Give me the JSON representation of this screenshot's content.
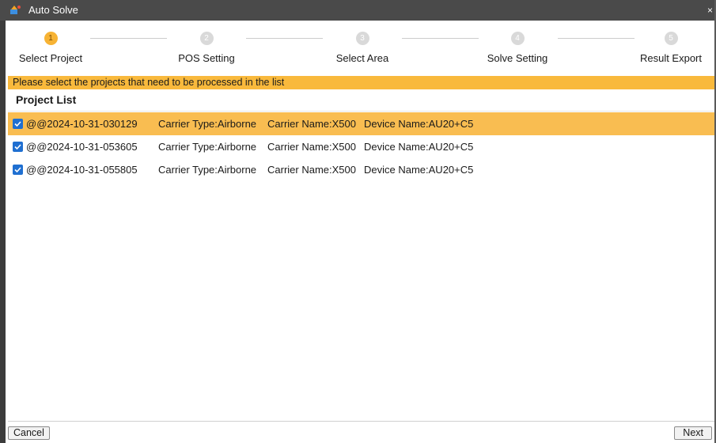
{
  "window": {
    "title": "Auto Solve",
    "close_glyph": "×",
    "icon": "app-logo-icon"
  },
  "steps": [
    {
      "number": "1",
      "label": "Select Project",
      "state": "active"
    },
    {
      "number": "2",
      "label": "POS Setting",
      "state": "inactive"
    },
    {
      "number": "3",
      "label": "Select Area",
      "state": "inactive"
    },
    {
      "number": "4",
      "label": "Solve Setting",
      "state": "inactive"
    },
    {
      "number": "5",
      "label": "Result Export",
      "state": "inactive"
    }
  ],
  "hint": "Please select the projects that need to be processed in the list",
  "list_title": "Project List",
  "projects": [
    {
      "checked": true,
      "selected": true,
      "name": "@@2024-10-31-030129",
      "carrier_type": "Carrier Type:Airborne",
      "carrier_name": "Carrier Name:X500",
      "device_name": "Device Name:AU20+C5"
    },
    {
      "checked": true,
      "selected": false,
      "name": "@@2024-10-31-053605",
      "carrier_type": "Carrier Type:Airborne",
      "carrier_name": "Carrier Name:X500",
      "device_name": "Device Name:AU20+C5"
    },
    {
      "checked": true,
      "selected": false,
      "name": "@@2024-10-31-055805",
      "carrier_type": "Carrier Type:Airborne",
      "carrier_name": "Carrier Name:X500",
      "device_name": "Device Name:AU20+C5"
    }
  ],
  "buttons": {
    "cancel": "Cancel",
    "next": "Next"
  },
  "colors": {
    "accent": "#f9b93c",
    "selected_row": "#f9bd51",
    "checkbox": "#1f6fd1",
    "inactive_step": "#d9d9d9"
  }
}
